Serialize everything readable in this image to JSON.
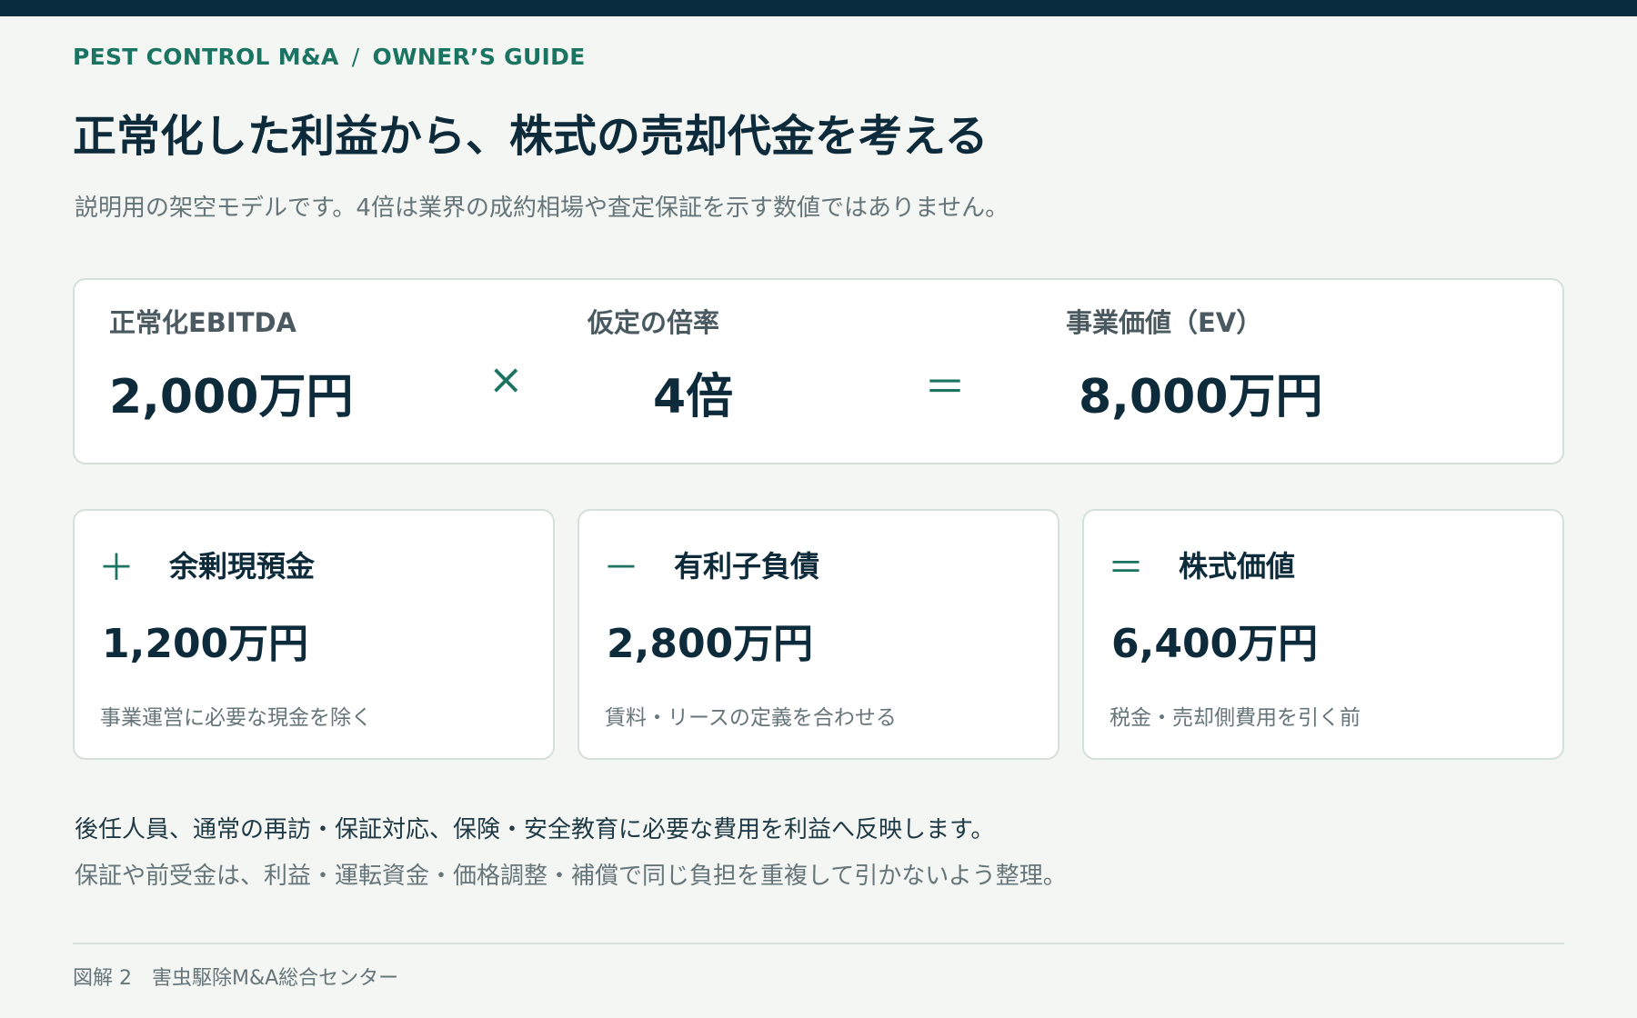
{
  "header": {
    "breadcrumb": [
      "PEST CONTROL M&A",
      "OWNER’S GUIDE"
    ],
    "breadcrumb_separator": "/",
    "title": "正常化した利益から、株式の売却代金を考える",
    "subtitle": "説明用の架空モデルです。4倍は業界の成約相場や査定保証を示す数値ではありません。"
  },
  "formula": {
    "ebitda": {
      "label": "正常化EBITDA",
      "value": "2,000万円"
    },
    "times_symbol": "×",
    "multiple": {
      "label": "仮定の倍率",
      "value": "4倍"
    },
    "equals_symbol": "＝",
    "ev": {
      "label": "事業価値（EV）",
      "value": "8,000万円"
    }
  },
  "adjustments": [
    {
      "op": "＋",
      "title": "余剰現預金",
      "value": "1,200万円",
      "note": "事業運営に必要な現金を除く"
    },
    {
      "op": "－",
      "title": "有利子負債",
      "value": "2,800万円",
      "note": "賃料・リースの定義を合わせる"
    },
    {
      "op": "＝",
      "title": "株式価値",
      "value": "6,400万円",
      "note": "税金・売却側費用を引く前"
    }
  ],
  "notes": [
    "後任人員、通常の再訪・保証対応、保険・安全教育に必要な費用を利益へ反映します。",
    "保証や前受金は、利益・運転資金・価格調整・補償で同じ負担を重複して引かないよう整理。"
  ],
  "footer": {
    "figure": "図解 2",
    "source": "害虫駆除M&A総合センター"
  },
  "colors": {
    "top_bar": "#092c3f",
    "accent": "#1b7462",
    "text_dark": "#0d2b3a",
    "text_muted": "#667579",
    "background": "#f3f6f3"
  }
}
